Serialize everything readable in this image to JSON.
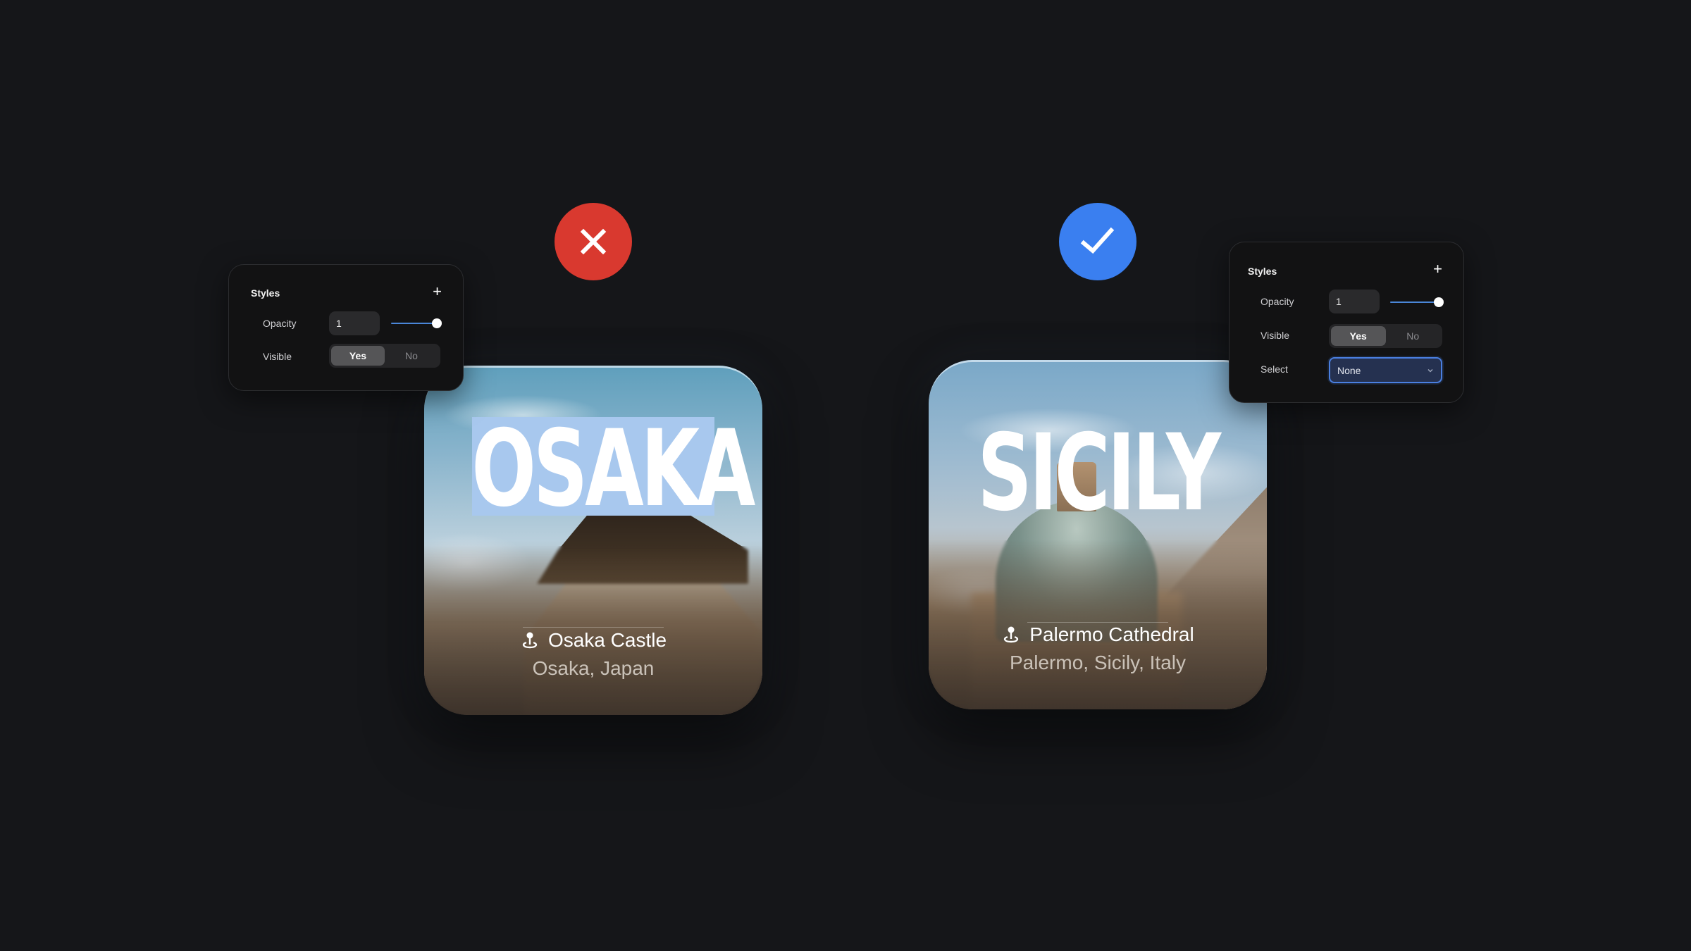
{
  "comparison": {
    "bad": {
      "icon": "x-mark-icon",
      "color": "#d9392f"
    },
    "good": {
      "icon": "check-mark-icon",
      "color": "#3a7ff0"
    }
  },
  "cards": [
    {
      "title": "OSAKA",
      "title_selected": true,
      "selection_color": "#a8c8ee",
      "place_name": "Osaka Castle",
      "place_icon": "location-pin-icon",
      "location": "Osaka, Japan"
    },
    {
      "title": "SICILY",
      "title_selected": false,
      "place_name": "Palermo Cathedral",
      "place_icon": "location-pin-icon",
      "location": "Palermo, Sicily, Italy"
    }
  ],
  "panels": [
    {
      "title": "Styles",
      "add_icon": "plus-icon",
      "opacity_label": "Opacity",
      "opacity_value": "1",
      "opacity_slider_fraction": 1.0,
      "visible_label": "Visible",
      "visible_options": [
        "Yes",
        "No"
      ],
      "visible_selected": "Yes"
    },
    {
      "title": "Styles",
      "add_icon": "plus-icon",
      "opacity_label": "Opacity",
      "opacity_value": "1",
      "opacity_slider_fraction": 1.0,
      "visible_label": "Visible",
      "visible_options": [
        "Yes",
        "No"
      ],
      "visible_selected": "Yes",
      "select_label": "Select",
      "select_value": "None",
      "accent_color": "#4a7fe0"
    }
  ]
}
